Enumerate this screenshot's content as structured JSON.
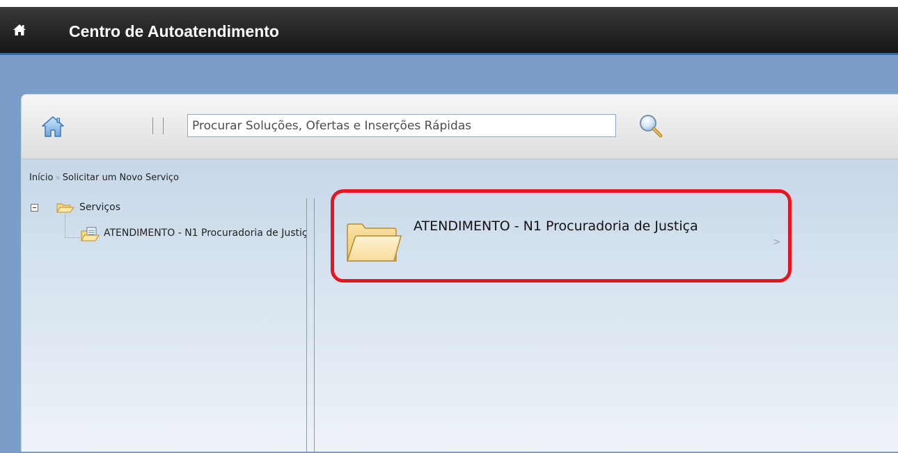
{
  "header": {
    "home_icon": "home-icon",
    "title": "Centro de Autoatendimento"
  },
  "toolbar": {
    "home_icon": "home-icon",
    "search_placeholder": "Procurar Soluções, Ofertas e Inserções Rápidas",
    "search_value": "",
    "search_button_icon": "magnifier-icon"
  },
  "breadcrumb": {
    "items": [
      "Início",
      "Solicitar um Novo Serviço"
    ],
    "separator": "»"
  },
  "tree": {
    "root": {
      "label": "Serviços",
      "expanded": true,
      "icon": "open-folder-icon"
    },
    "children": [
      {
        "label": "ATENDIMENTO - N1 Procuradoria de Justiça",
        "icon": "document-folder-icon"
      }
    ]
  },
  "catalog": {
    "items": [
      {
        "label": "ATENDIMENTO - N1 Procuradoria de Justiça",
        "icon": "folder-icon",
        "chevron": ">"
      }
    ]
  },
  "colors": {
    "titlebar": "#1f1f1f",
    "band": "#7a9ec9",
    "highlight": "#e8141f",
    "content_top": "#c7d8e9"
  }
}
